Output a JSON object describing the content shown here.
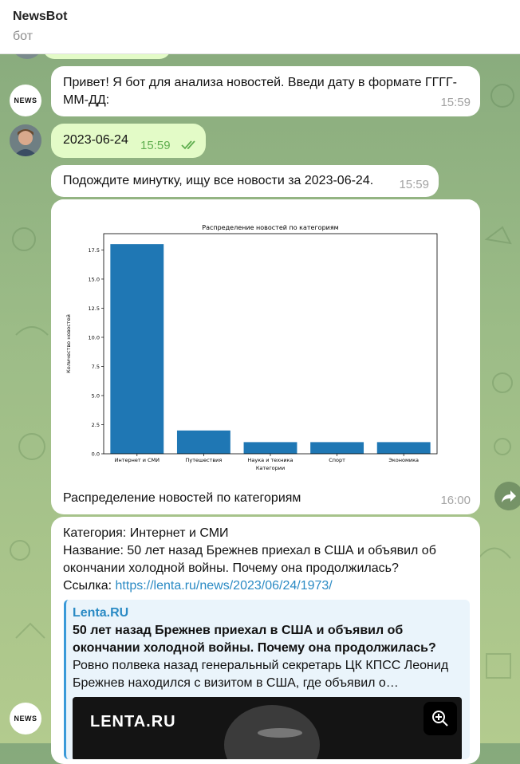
{
  "header": {
    "title": "NewsBot",
    "subtitle": "бот"
  },
  "bot_avatar_label": "NEWS",
  "messages": {
    "greeting": {
      "text": "Привет! Я бот для анализа новостей. Введи дату в формате ГГГГ-ММ-ДД:",
      "time": "15:59"
    },
    "user_date": {
      "text": "2023-06-24",
      "time": "15:59"
    },
    "waiting": {
      "text": "Подождите минутку, ищу все новости за 2023-06-24.",
      "time": "15:59"
    },
    "chart_msg": {
      "caption": "Распределение новостей по категориям",
      "time": "16:00"
    },
    "news": {
      "category": "Категория: Интернет и СМИ",
      "title_line": "Название: 50 лет назад Брежнев приехал в США и объявил об окончании холодной войны. Почему она продолжилась?",
      "link_label": "Ссылка: ",
      "link_url": "https://lenta.ru/news/2023/06/24/1973/",
      "preview": {
        "site": "Lenta.RU",
        "title": "50 лет назад Брежнев приехал в США и объявил об окончании холодной войны. Почему она продолжилась?",
        "description": "Ровно полвека назад генеральный секретарь ЦК КПСС Леонид Брежнев находился с визитом в США, где объявил о…",
        "logo": "LENTA.RU"
      }
    }
  },
  "chart_data": {
    "type": "bar",
    "title": "Распределение новостей по категориям",
    "xlabel": "Категории",
    "ylabel": "Количество новостей",
    "categories": [
      "Интернет и СМИ",
      "Путешествия",
      "Наука и техника",
      "Спорт",
      "Экономика"
    ],
    "values": [
      18,
      2,
      1,
      1,
      1
    ],
    "ylim": [
      0,
      18.9
    ],
    "yticks": [
      "0.0",
      "2.5",
      "5.0",
      "7.5",
      "10.0",
      "12.5",
      "15.0",
      "17.5"
    ],
    "bar_color": "#1f77b4",
    "grid": false
  },
  "colors": {
    "incoming": "#ffffff",
    "outgoing": "#e3fbc7",
    "link": "#2a8ac4",
    "accent": "#3a9ad9"
  }
}
